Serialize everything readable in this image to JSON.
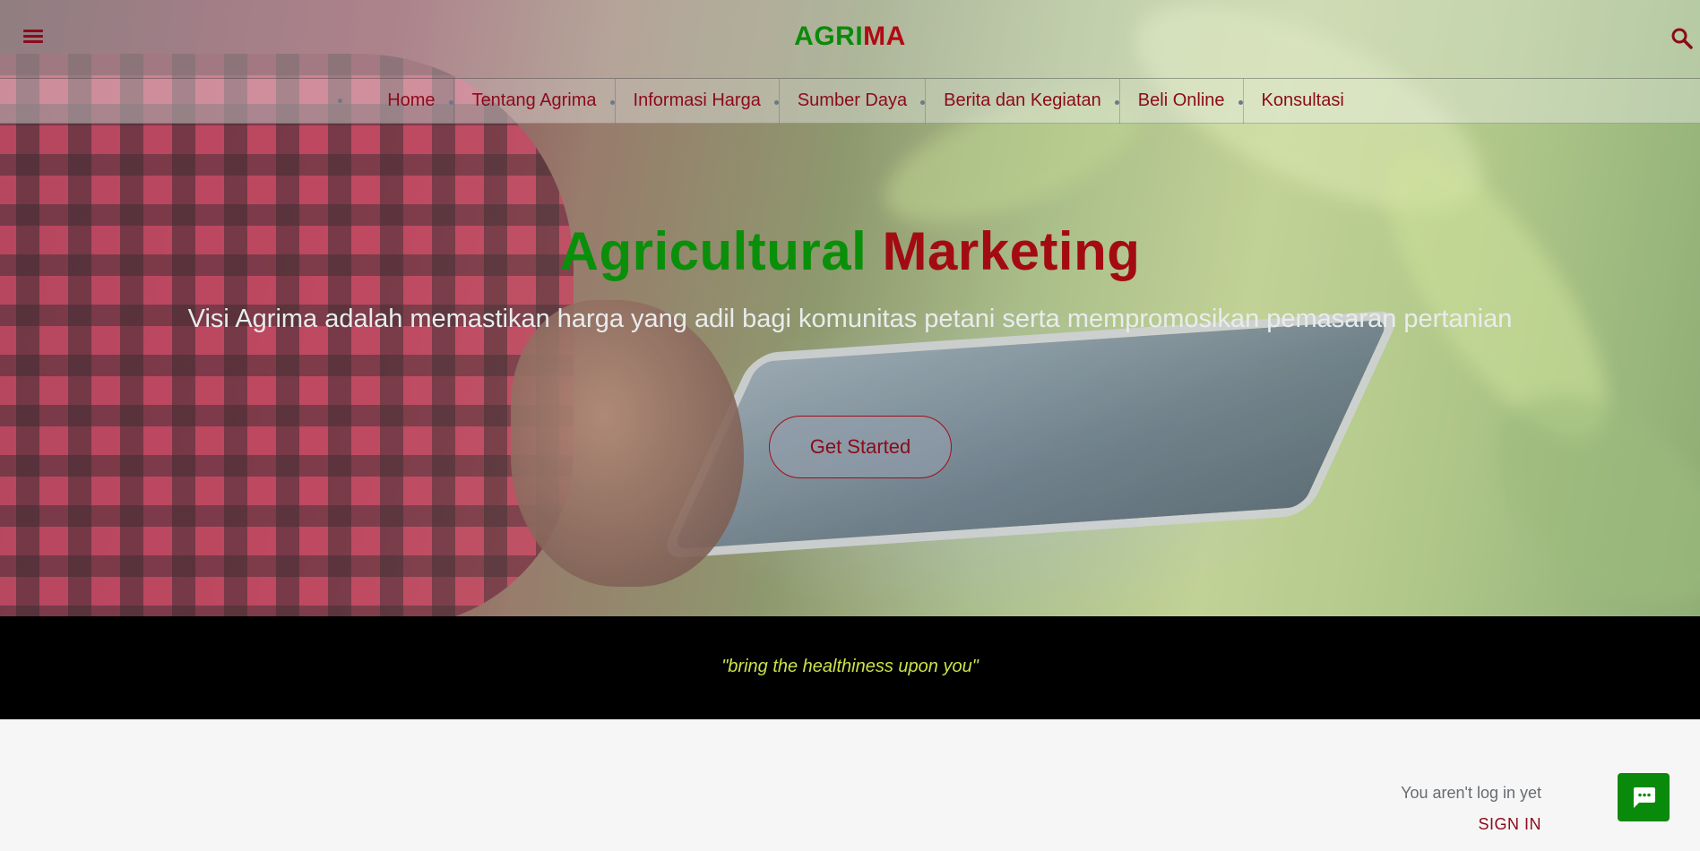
{
  "header": {
    "menu_icon": "menu-icon",
    "brand_green": "AGRI",
    "brand_red": "MA",
    "search_icon": "search-icon"
  },
  "nav": {
    "items": [
      {
        "label": "Home"
      },
      {
        "label": "Tentang Agrima"
      },
      {
        "label": "Informasi Harga"
      },
      {
        "label": "Sumber Daya"
      },
      {
        "label": "Berita dan Kegiatan"
      },
      {
        "label": "Beli Online"
      },
      {
        "label": "Konsultasi"
      }
    ]
  },
  "hero": {
    "title_green": "Agricultural",
    "title_red": "Marketing",
    "subtitle": "Visi Agrima adalah memastikan harga yang adil bagi komunitas petani serta mempromosikan pemasaran pertanian",
    "cta_label": "Get Started"
  },
  "tagline": {
    "text": "\"bring the healthiness upon you\""
  },
  "account": {
    "note": "You aren't log in yet",
    "sign_in": "SIGN IN"
  },
  "chat": {
    "icon": "chat-icon"
  },
  "colors": {
    "brand_green": "#0a8f0a",
    "brand_red": "#a30b13",
    "tagline": "#cde24a",
    "chat_button": "#0a8a0a"
  }
}
